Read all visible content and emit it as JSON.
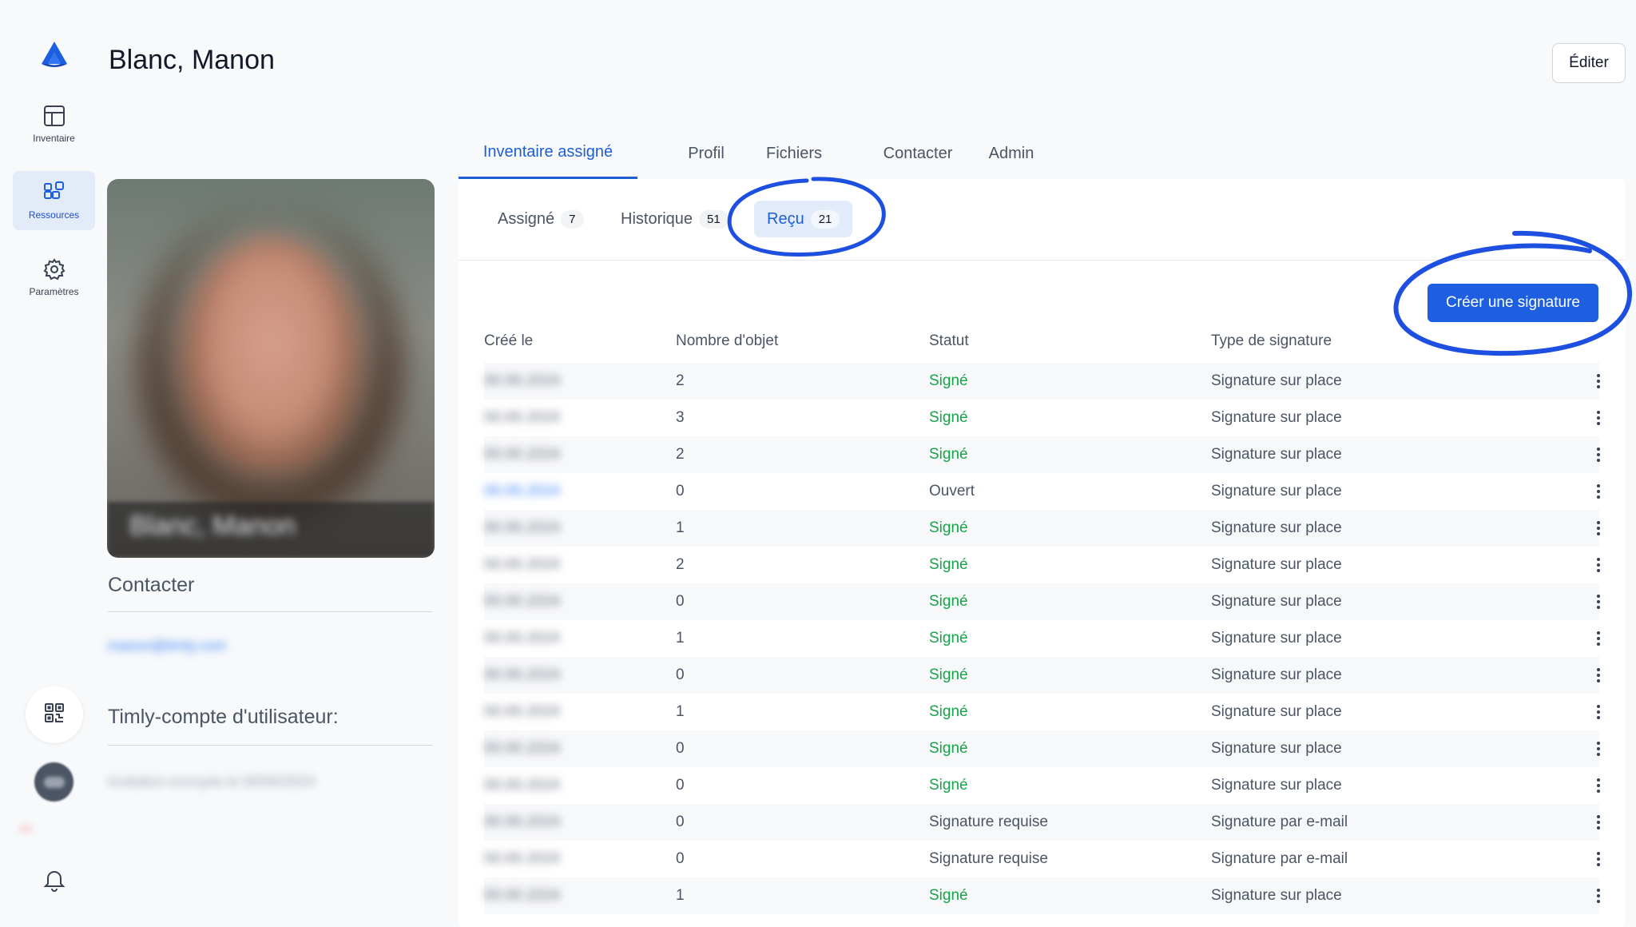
{
  "app": {
    "title": "Blanc, Manon",
    "edit_label": "Éditer"
  },
  "sidebar": {
    "items": [
      {
        "label": "Inventaire",
        "icon": "grid-icon"
      },
      {
        "label": "Ressources",
        "icon": "resources-icon",
        "active": true
      },
      {
        "label": "Paramètres",
        "icon": "gear-icon"
      }
    ],
    "badge_blurred": "•••"
  },
  "profile": {
    "photo_name": "Blanc, Manon",
    "contact_title": "Contacter",
    "email": "manon@timly.com",
    "account_title": "Timly-compte d'utilisateur:",
    "account_status": "Invitation envoyée le 00/00/2024"
  },
  "main_tabs": [
    {
      "label": "Inventaire assigné",
      "active": true
    },
    {
      "label": "Profil"
    },
    {
      "label": "Fichiers"
    },
    {
      "label": "Contacter"
    },
    {
      "label": "Admin"
    }
  ],
  "subtabs": [
    {
      "label": "Assigné",
      "count": "7"
    },
    {
      "label": "Historique",
      "count": "51"
    },
    {
      "label": "Reçu",
      "count": "21",
      "active": true
    }
  ],
  "create_button": "Créer une signature",
  "table": {
    "headers": [
      "Créé le",
      "Nombre d'objet",
      "Statut",
      "Type de signature"
    ],
    "rows": [
      {
        "date": "00.00.2024",
        "count": "2",
        "status": "Signé",
        "type": "Signature sur place"
      },
      {
        "date": "00.00.2024",
        "count": "3",
        "status": "Signé",
        "type": "Signature sur place"
      },
      {
        "date": "00.00.2024",
        "count": "2",
        "status": "Signé",
        "type": "Signature sur place"
      },
      {
        "date": "00.00.2024",
        "count": "0",
        "status": "Ouvert",
        "type": "Signature sur place"
      },
      {
        "date": "00.00.2024",
        "count": "1",
        "status": "Signé",
        "type": "Signature sur place"
      },
      {
        "date": "00.00.2024",
        "count": "2",
        "status": "Signé",
        "type": "Signature sur place"
      },
      {
        "date": "00.00.2024",
        "count": "0",
        "status": "Signé",
        "type": "Signature sur place"
      },
      {
        "date": "00.00.2024",
        "count": "1",
        "status": "Signé",
        "type": "Signature sur place"
      },
      {
        "date": "00.00.2024",
        "count": "0",
        "status": "Signé",
        "type": "Signature sur place"
      },
      {
        "date": "00.00.2024",
        "count": "1",
        "status": "Signé",
        "type": "Signature sur place"
      },
      {
        "date": "00.00.2024",
        "count": "0",
        "status": "Signé",
        "type": "Signature sur place"
      },
      {
        "date": "00.00.2024",
        "count": "0",
        "status": "Signé",
        "type": "Signature sur place"
      },
      {
        "date": "00.00.2024",
        "count": "0",
        "status": "Signature requise",
        "type": "Signature par e-mail"
      },
      {
        "date": "00.00.2024",
        "count": "0",
        "status": "Signature requise",
        "type": "Signature par e-mail"
      },
      {
        "date": "00.00.2024",
        "count": "1",
        "status": "Signé",
        "type": "Signature sur place"
      }
    ]
  },
  "colors": {
    "accent": "#1d5fe0",
    "signed": "#16a34a",
    "annotation": "#1d4fe0"
  }
}
